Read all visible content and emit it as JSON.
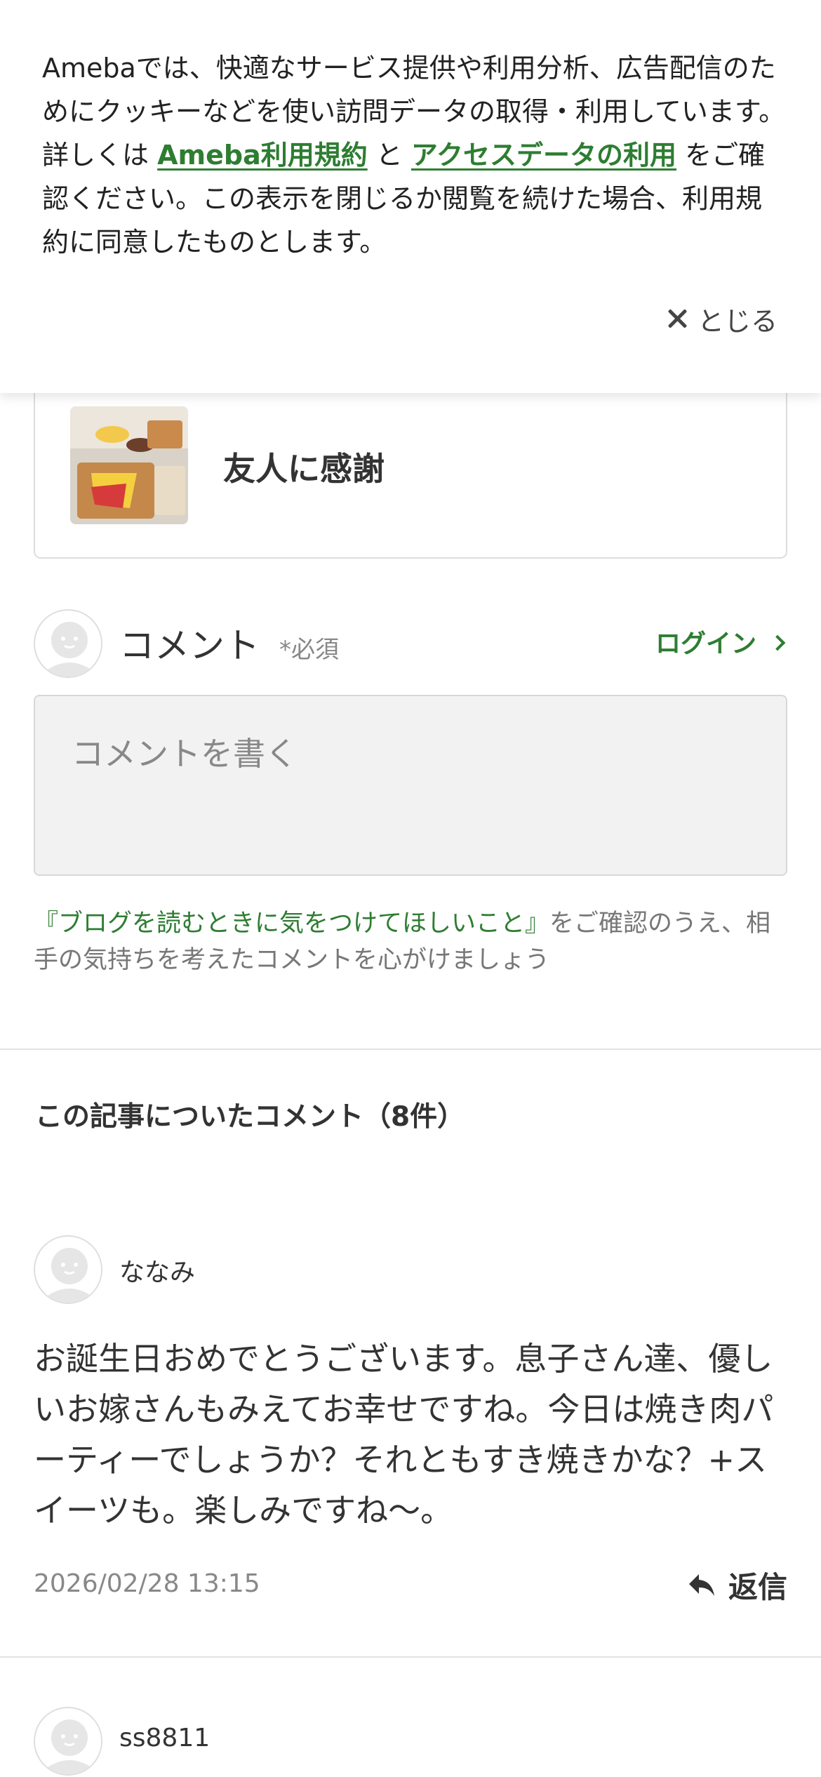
{
  "cookie_banner": {
    "text_1": "Amebaでは、快適なサービス提供や利用分析、広告配信のためにクッキーなどを使い訪問データの取得・利用しています。詳しくは ",
    "link_terms": "Ameba利用規約",
    "text_2": " と ",
    "link_access": "アクセスデータの利用",
    "text_3": " をご確認ください。この表示を閉じるか閲覧を続けた場合、利用規約に同意したものとします。",
    "close_label": "とじる"
  },
  "article_card": {
    "title": "友人に感謝"
  },
  "comment_form": {
    "heading": "コメント",
    "required": "*必須",
    "login_label": "ログイン",
    "placeholder": "コメントを書く",
    "guideline_link": "『ブログを読むときに気をつけてほしいこと』",
    "guideline_text": "をご確認のうえ、相手の気持ちを考えたコメントを心がけましょう"
  },
  "comments_section": {
    "heading": "この記事についたコメント（8件）",
    "comments": [
      {
        "author": "ななみ",
        "body": "お誕生日おめでとうございます。息子さん達、優しいお嫁さんもみえてお幸せですね。今日は焼き肉パーティーでしょうか？それともすき焼きかな？+スイーツも。楽しみですね〜。",
        "date": "2026/02/28 13:15",
        "reply_label": "返信"
      },
      {
        "author": "ss8811"
      }
    ]
  },
  "colors": {
    "accent_green": "#2e7d32",
    "text": "#333333",
    "muted": "#888888"
  },
  "icons": [
    "close-icon",
    "chevron-right-icon",
    "avatar-icon",
    "reply-icon"
  ]
}
